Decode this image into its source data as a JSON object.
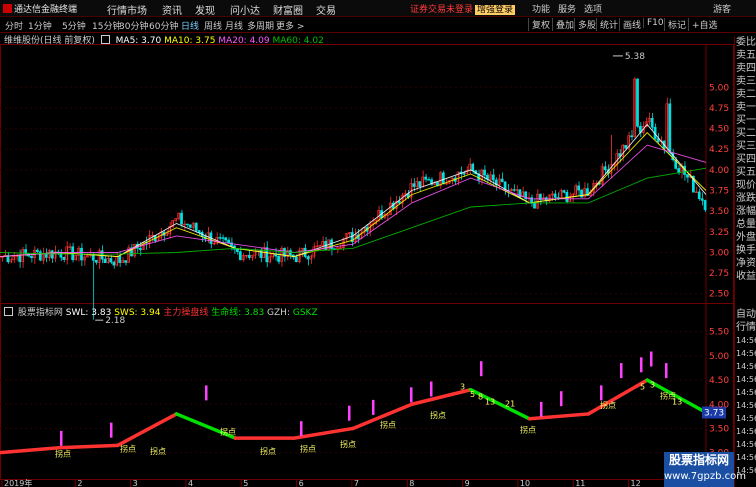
{
  "app": {
    "logo_text": "通达信金融终端"
  },
  "menu": [
    "行情",
    "市场",
    "资讯",
    "发现",
    "问小达",
    "财富圈",
    "交易"
  ],
  "notice": {
    "text": "证券交易未登录",
    "link": "增强登录"
  },
  "right_menu": [
    "功能",
    "服务",
    "选项",
    "游客"
  ],
  "periods": [
    "分时",
    "1分钟",
    "5分钟",
    "15分钟",
    "30分钟",
    "60分钟",
    "日线",
    "周线",
    "月线",
    "多周期",
    "更多 >"
  ],
  "active_period": "日线",
  "tools": [
    "复权",
    "叠加",
    "多股",
    "统计",
    "画线",
    "F10",
    "标记",
    "+自选"
  ],
  "main_indicator": {
    "stock": "维维股份(日线 前复权)",
    "ma5": "MA5: 3.70",
    "ma10": "MA10: 3.75",
    "ma20": "MA20: 4.09",
    "ma60": "MA60: 4.02"
  },
  "sub_indicator": {
    "name": "股票指标网",
    "swl": "SWL: 3.83",
    "sws": "SWS: 3.94",
    "zljx": "主力操盘线",
    "sml": "生命线: 3.83",
    "gzh": "GZH:",
    "gskz": "GSKZ"
  },
  "price_axis": [
    "5.00",
    "4.75",
    "4.50",
    "4.25",
    "4.00",
    "3.75",
    "3.50",
    "3.25",
    "3.00",
    "2.75",
    "2.50"
  ],
  "sub_axis": [
    "5.50",
    "5.00",
    "4.50",
    "4.00",
    "3.50",
    "3.00"
  ],
  "annotations": {
    "high": "5.38",
    "low": "2.18",
    "current": "3.73"
  },
  "months": [
    "2019年",
    "2",
    "3",
    "4",
    "5",
    "6",
    "7",
    "8",
    "9",
    "10",
    "11",
    "12"
  ],
  "right_panel_top": [
    "委比",
    "卖五",
    "卖四",
    "卖三",
    "卖二",
    "卖一",
    "买一",
    "买二",
    "买三",
    "买四",
    "买五",
    "现价",
    "涨跌",
    "涨幅",
    "总量",
    "外盘",
    "换手",
    "净资",
    "收益"
  ],
  "right_panel_bottom": [
    "自动",
    "行情",
    "14:56",
    "14:56",
    "14:56",
    "14:56",
    "14:56",
    "14:56",
    "14:56",
    "14:56",
    "14:56",
    "14:56",
    "14:56"
  ],
  "signal_labels": {
    "pivot": "拐点",
    "n3": "3",
    "n5": "5",
    "n8": "8",
    "n9": "9",
    "n13": "13",
    "n21": "21"
  },
  "watermark": {
    "line1": "股票指标网",
    "line2": "www.7gpzb.com"
  },
  "colors": {
    "up": "#ff3232",
    "down": "#00e0e0",
    "ma5": "#ffffff",
    "ma10": "#ffff00",
    "ma20": "#ff55ff",
    "ma60": "#00c000"
  },
  "chart_data": [
    {
      "type": "candlestick",
      "title": "维维股份(日线 前复权)",
      "ylim": [
        2.4,
        5.5
      ],
      "x": [
        "2019-01",
        "2019-02",
        "2019-03",
        "2019-04",
        "2019-05",
        "2019-06",
        "2019-07",
        "2019-08",
        "2019-09",
        "2019-10",
        "2019-11",
        "2019-12",
        "2020-01"
      ],
      "close": [
        2.95,
        3.0,
        2.9,
        3.4,
        3.0,
        2.95,
        3.2,
        3.8,
        4.0,
        3.6,
        3.75,
        4.6,
        3.6
      ],
      "series": [
        {
          "name": "MA5",
          "values": [
            2.95,
            3.0,
            2.95,
            3.35,
            3.05,
            2.95,
            3.2,
            3.75,
            4.0,
            3.6,
            3.7,
            4.55,
            3.7
          ]
        },
        {
          "name": "MA10",
          "values": [
            2.95,
            3.0,
            2.95,
            3.3,
            3.05,
            2.95,
            3.15,
            3.7,
            3.95,
            3.6,
            3.7,
            4.45,
            3.75
          ]
        },
        {
          "name": "MA20",
          "values": [
            2.95,
            3.0,
            3.0,
            3.2,
            3.1,
            3.0,
            3.1,
            3.6,
            3.9,
            3.65,
            3.65,
            4.3,
            4.09
          ]
        },
        {
          "name": "MA60",
          "values": [
            3.0,
            2.98,
            2.98,
            3.0,
            3.05,
            3.0,
            3.05,
            3.3,
            3.55,
            3.6,
            3.6,
            3.9,
            4.02
          ]
        }
      ]
    },
    {
      "type": "line",
      "title": "股票指标网",
      "ylim": [
        2.6,
        5.7
      ],
      "x": [
        "2019-01",
        "2019-02",
        "2019-03",
        "2019-04",
        "2019-05",
        "2019-06",
        "2019-07",
        "2019-08",
        "2019-09",
        "2019-10",
        "2019-11",
        "2019-12",
        "2020-01"
      ],
      "series": [
        {
          "name": "SWL",
          "values": [
            3.0,
            3.1,
            3.15,
            3.8,
            3.3,
            3.3,
            3.5,
            4.0,
            4.3,
            3.7,
            3.8,
            4.5,
            3.83
          ]
        }
      ]
    }
  ]
}
